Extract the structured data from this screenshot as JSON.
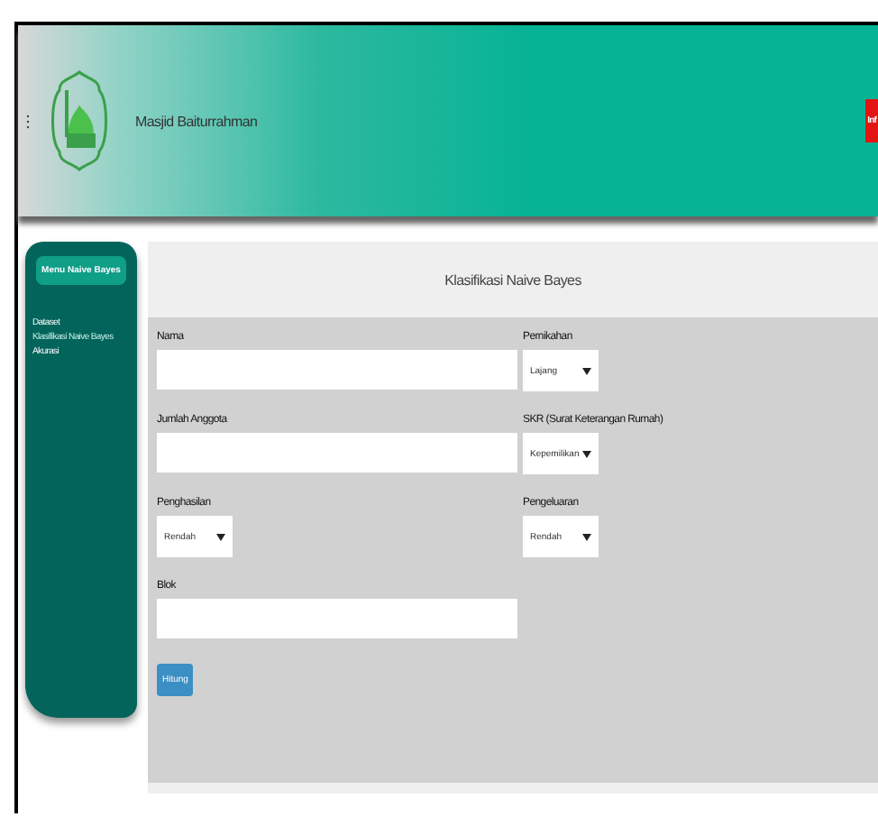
{
  "header": {
    "title": "Masjid Baiturrahman",
    "button": "Inf"
  },
  "sidebar": {
    "menu_button": "Menu Naive Bayes",
    "items": [
      {
        "label": "Dataset",
        "selected": false
      },
      {
        "label": "Klasifikasi Naive Bayes",
        "selected": true
      },
      {
        "label": "Akurasi",
        "selected": false
      }
    ]
  },
  "card": {
    "title": "Klasifikasi Naive Bayes",
    "fields": [
      {
        "kind": "text",
        "label": "Nama"
      },
      {
        "kind": "select",
        "label": "Pernikahan",
        "value": "Lajang"
      },
      {
        "kind": "text",
        "label": "Jumlah Anggota"
      },
      {
        "kind": "select",
        "label": "SKR (Surat Keterangan Rumah)",
        "value": "Kepemilikan"
      },
      {
        "kind": "select",
        "label": "Penghasilan",
        "value": "Rendah"
      },
      {
        "kind": "select",
        "label": "Pengeluaran",
        "value": "Rendah"
      },
      {
        "kind": "text",
        "label": "Blok"
      }
    ],
    "button": "Hitung"
  }
}
